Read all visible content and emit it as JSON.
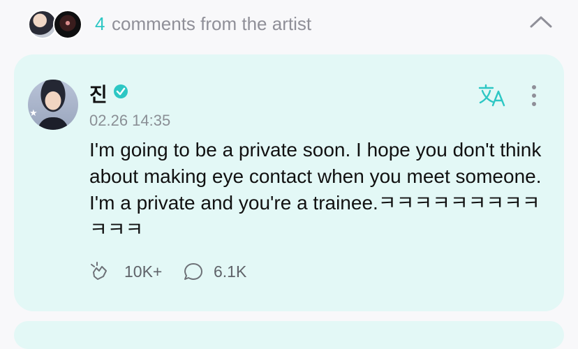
{
  "header": {
    "count": "4",
    "text": "comments from the artist"
  },
  "comment": {
    "author": "진",
    "timestamp": "02.26 14:35",
    "body": "I'm going to be a private soon. I hope you don't think about making eye contact when you meet someone. I'm a private and you're a trainee.ㅋㅋㅋㅋㅋㅋㅋㅋㅋㅋㅋㅋ",
    "likes": "10K+",
    "replies": "6.1K"
  },
  "colors": {
    "accent": "#2dc7c4",
    "card_bg": "#e3f8f6"
  },
  "icons": [
    "chevron-up-icon",
    "verified-badge-icon",
    "translate-icon",
    "more-vertical-icon",
    "cheer-icon",
    "comment-bubble-icon"
  ]
}
